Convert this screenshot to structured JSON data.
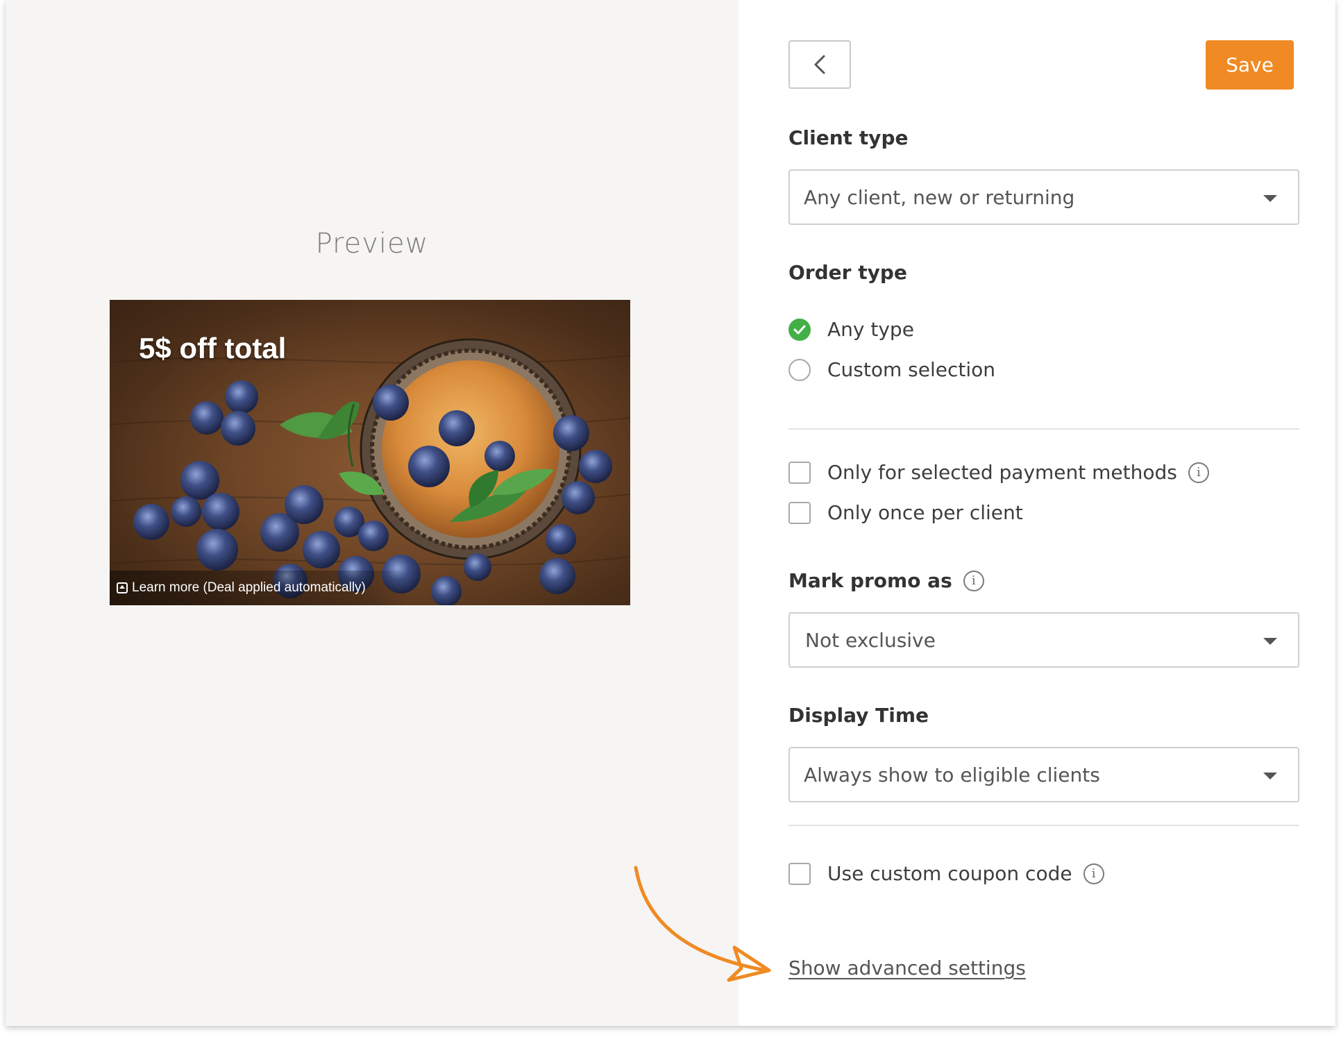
{
  "preview": {
    "title": "Preview",
    "card": {
      "title": "5$ off total",
      "footer": "Learn more (Deal applied automatically)",
      "icon": "learn-more-icon"
    }
  },
  "header": {
    "back_icon": "chevron-left-icon",
    "save_label": "Save"
  },
  "client_type": {
    "label": "Client type",
    "selected": "Any client, new or returning"
  },
  "order_type": {
    "label": "Order type",
    "options": [
      {
        "label": "Any type",
        "selected": true
      },
      {
        "label": "Custom selection",
        "selected": false
      }
    ]
  },
  "restrictions": [
    {
      "label": "Only for selected payment methods",
      "checked": false,
      "has_info": true
    },
    {
      "label": "Only once per client",
      "checked": false,
      "has_info": false
    }
  ],
  "mark_promo": {
    "label": "Mark promo as",
    "selected": "Not exclusive"
  },
  "display_time": {
    "label": "Display Time",
    "selected": "Always show to eligible clients"
  },
  "coupon": {
    "label": "Use custom coupon code",
    "checked": false
  },
  "advanced_link": "Show advanced settings",
  "colors": {
    "accent": "#f08a24",
    "radio_checked": "#43b047",
    "preview_bg": "#f6f5f3"
  }
}
